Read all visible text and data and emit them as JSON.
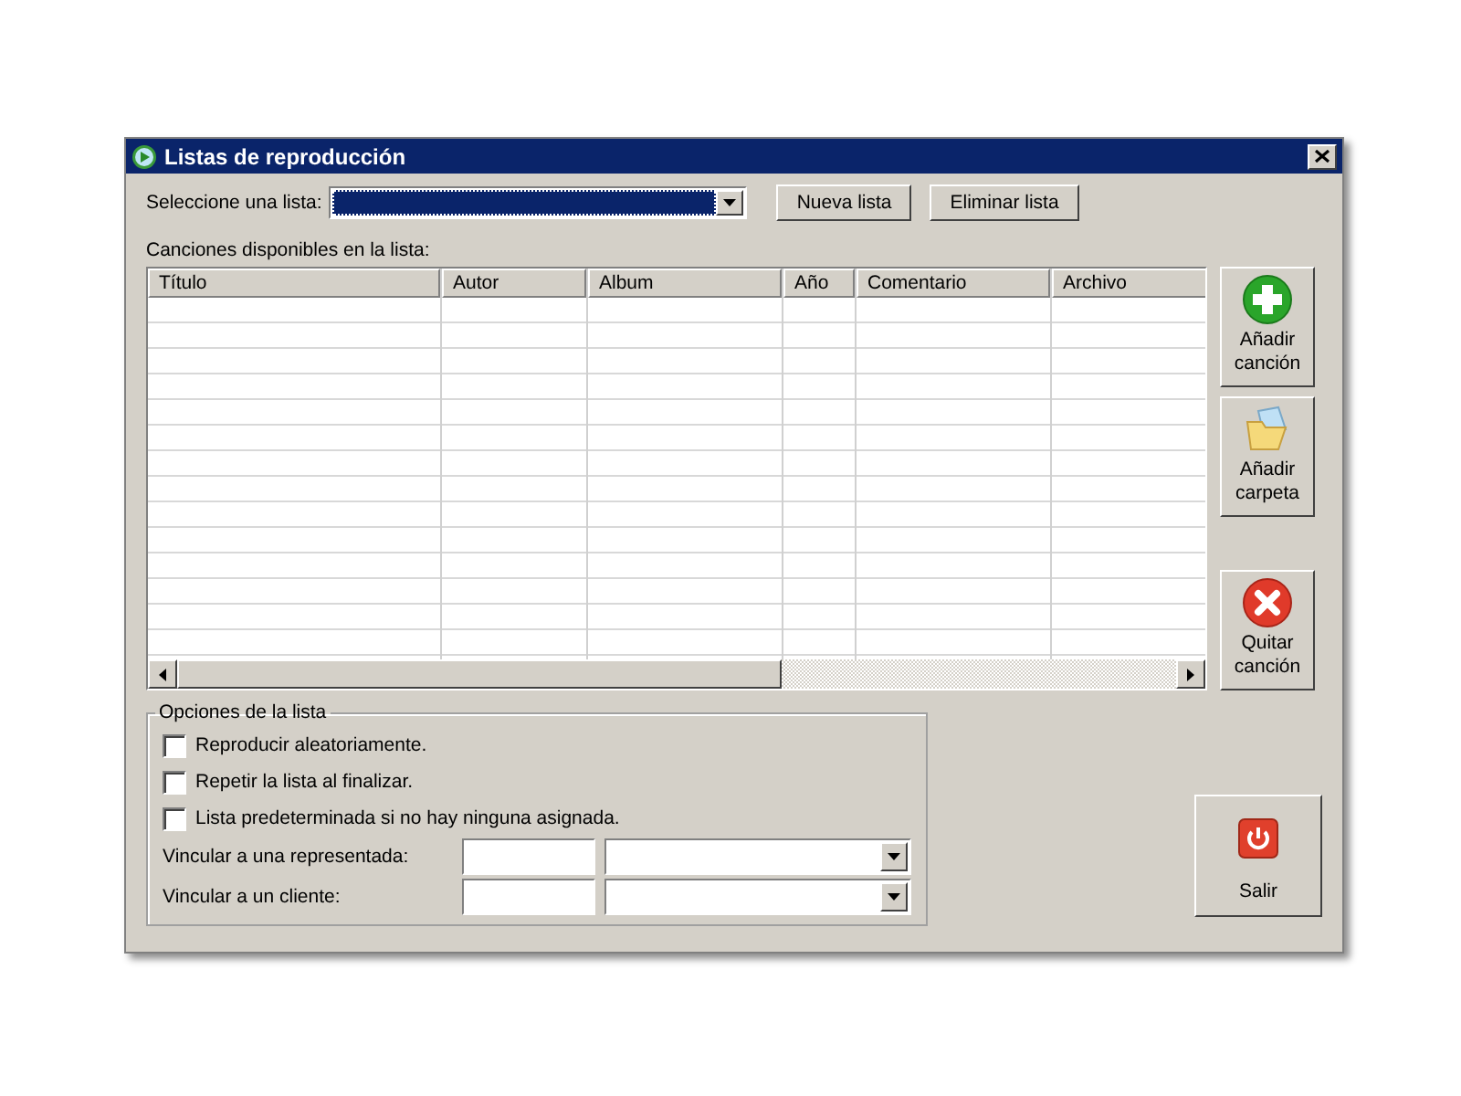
{
  "window": {
    "title": "Listas de reproducción"
  },
  "playlist_select": {
    "label": "Seleccione una lista:",
    "focused": true
  },
  "playlist_buttons": [
    "Nueva lista",
    "Eliminar lista"
  ],
  "songs_label": "Canciones disponibles en la lista:",
  "table": {
    "columns": [
      "Título",
      "Autor",
      "Album",
      "Año",
      "Comentario",
      "Archivo"
    ]
  },
  "side_buttons": [
    {
      "kind": "add",
      "label": "Añadir canción"
    },
    {
      "kind": "folder",
      "label": "Añadir carpeta"
    },
    {
      "kind": "remove",
      "label": "Quitar canción"
    }
  ],
  "options": {
    "title": "Opciones de la lista",
    "checkboxes": [
      {
        "label": "Reproducir aleatoriamente.",
        "checked": false
      },
      {
        "label": "Repetir la lista al finalizar.",
        "checked": false
      },
      {
        "label": "Lista predeterminada si no hay ninguna asignada.",
        "checked": false
      }
    ],
    "links": [
      {
        "label": "Vincular a una representada:"
      },
      {
        "label": "Vincular a un cliente:"
      }
    ]
  },
  "exit_button": {
    "label": "Salir"
  }
}
